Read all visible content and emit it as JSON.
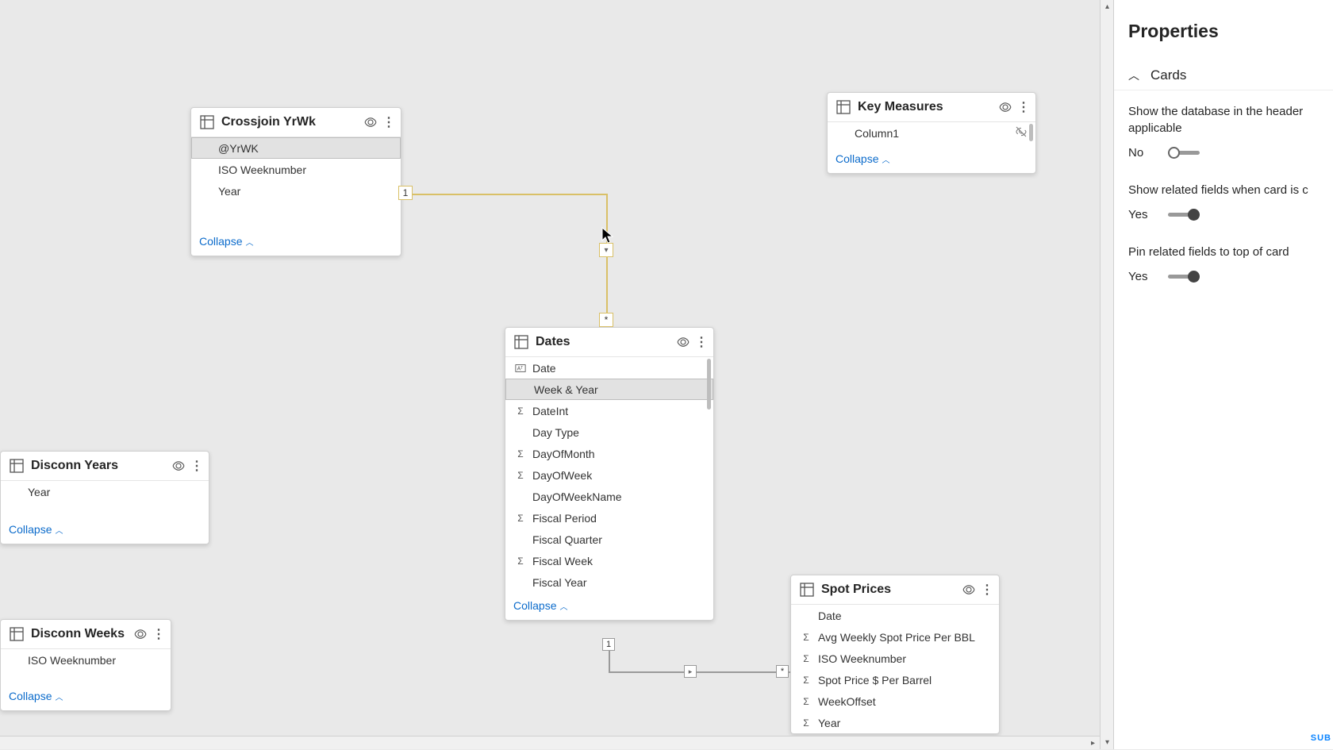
{
  "properties": {
    "title": "Properties",
    "section": "Cards",
    "opt1": {
      "label": "Show the database in the header applicable",
      "value": "No"
    },
    "opt2": {
      "label": "Show related fields when card is c",
      "value": "Yes"
    },
    "opt3": {
      "label": "Pin related fields to top of card",
      "value": "Yes"
    }
  },
  "tables": {
    "crossjoin": {
      "title": "Crossjoin YrWk",
      "fields": [
        "@YrWK",
        "ISO Weeknumber",
        "Year"
      ],
      "collapse": "Collapse"
    },
    "keymeasures": {
      "title": "Key Measures",
      "fields": [
        "Column1"
      ],
      "collapse": "Collapse"
    },
    "disconnYears": {
      "title": "Disconn Years",
      "fields": [
        "Year"
      ],
      "collapse": "Collapse"
    },
    "disconnWeeks": {
      "title": "Disconn Weeks",
      "fields": [
        "ISO Weeknumber"
      ],
      "collapse": "Collapse"
    },
    "dates": {
      "title": "Dates",
      "fields": [
        "Date",
        "Week & Year",
        "DateInt",
        "Day Type",
        "DayOfMonth",
        "DayOfWeek",
        "DayOfWeekName",
        "Fiscal Period",
        "Fiscal Quarter",
        "Fiscal Week",
        "Fiscal Year"
      ],
      "collapse": "Collapse"
    },
    "spot": {
      "title": "Spot Prices",
      "fields": [
        "Date",
        "Avg Weekly Spot Price Per BBL",
        "ISO Weeknumber",
        "Spot Price $ Per Barrel",
        "WeekOffset",
        "Year"
      ],
      "collapse": "Collapse"
    }
  },
  "rel": {
    "one": "1",
    "many": "*"
  },
  "sub": "SUB"
}
